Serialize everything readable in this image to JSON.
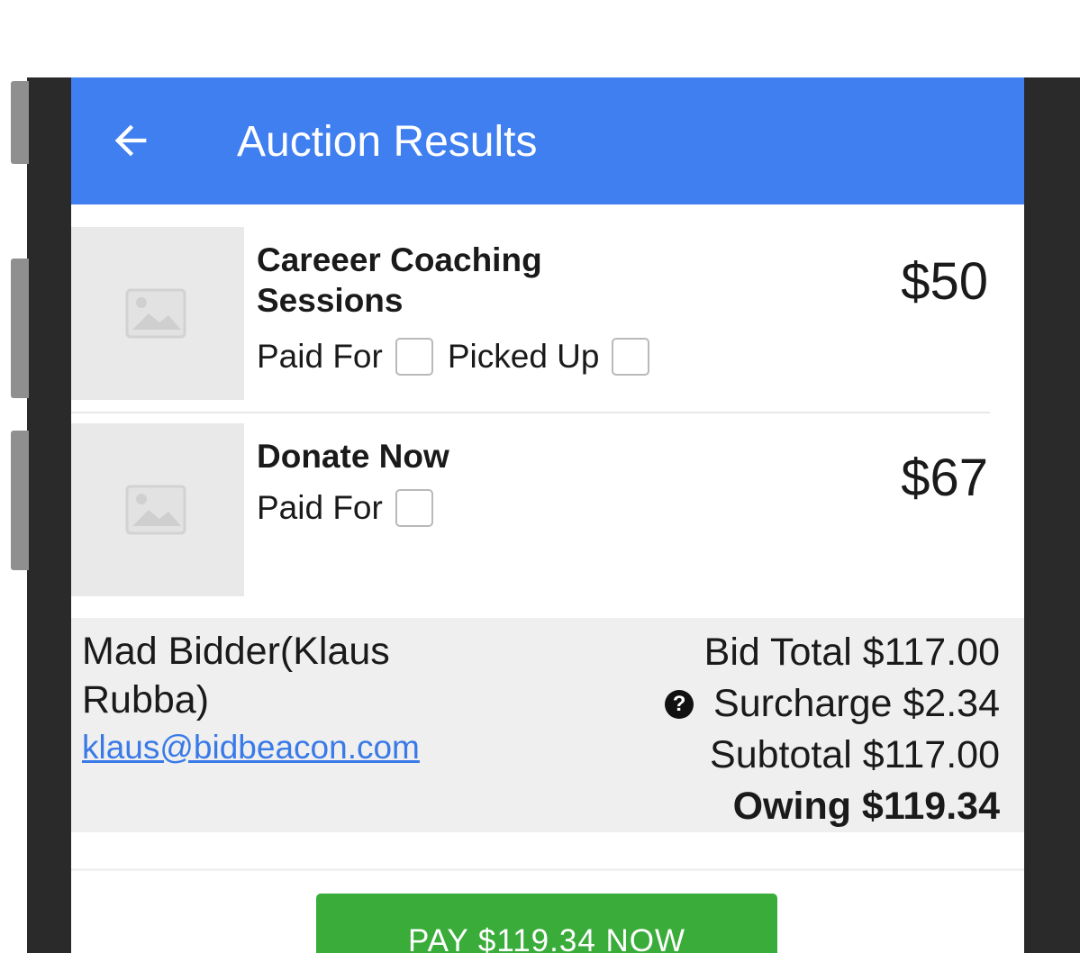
{
  "app_bar": {
    "title": "Auction Results",
    "back_icon": "arrow-left-icon",
    "color": "#3f7ff0"
  },
  "items": [
    {
      "title": "Careeer Coaching Sessions",
      "price": "$50",
      "thumbnail_icon": "image-placeholder-icon",
      "checkboxes": [
        {
          "label": "Paid For",
          "checked": false
        },
        {
          "label": "Picked Up",
          "checked": false
        }
      ]
    },
    {
      "title": "Donate Now",
      "price": "$67",
      "thumbnail_icon": "image-placeholder-icon",
      "checkboxes": [
        {
          "label": "Paid For",
          "checked": false
        }
      ]
    }
  ],
  "summary": {
    "bidder_name": "Mad Bidder(Klaus Rubba)",
    "email": "klaus@bidbeacon.com",
    "bid_total": "Bid Total $117.00",
    "surcharge": "Surcharge $2.34",
    "surcharge_help_icon": "question-circle-icon",
    "subtotal": "Subtotal $117.00",
    "owing": "Owing $119.34"
  },
  "pay_button": {
    "label": "PAY $119.34 NOW",
    "color": "#3aac3a"
  }
}
